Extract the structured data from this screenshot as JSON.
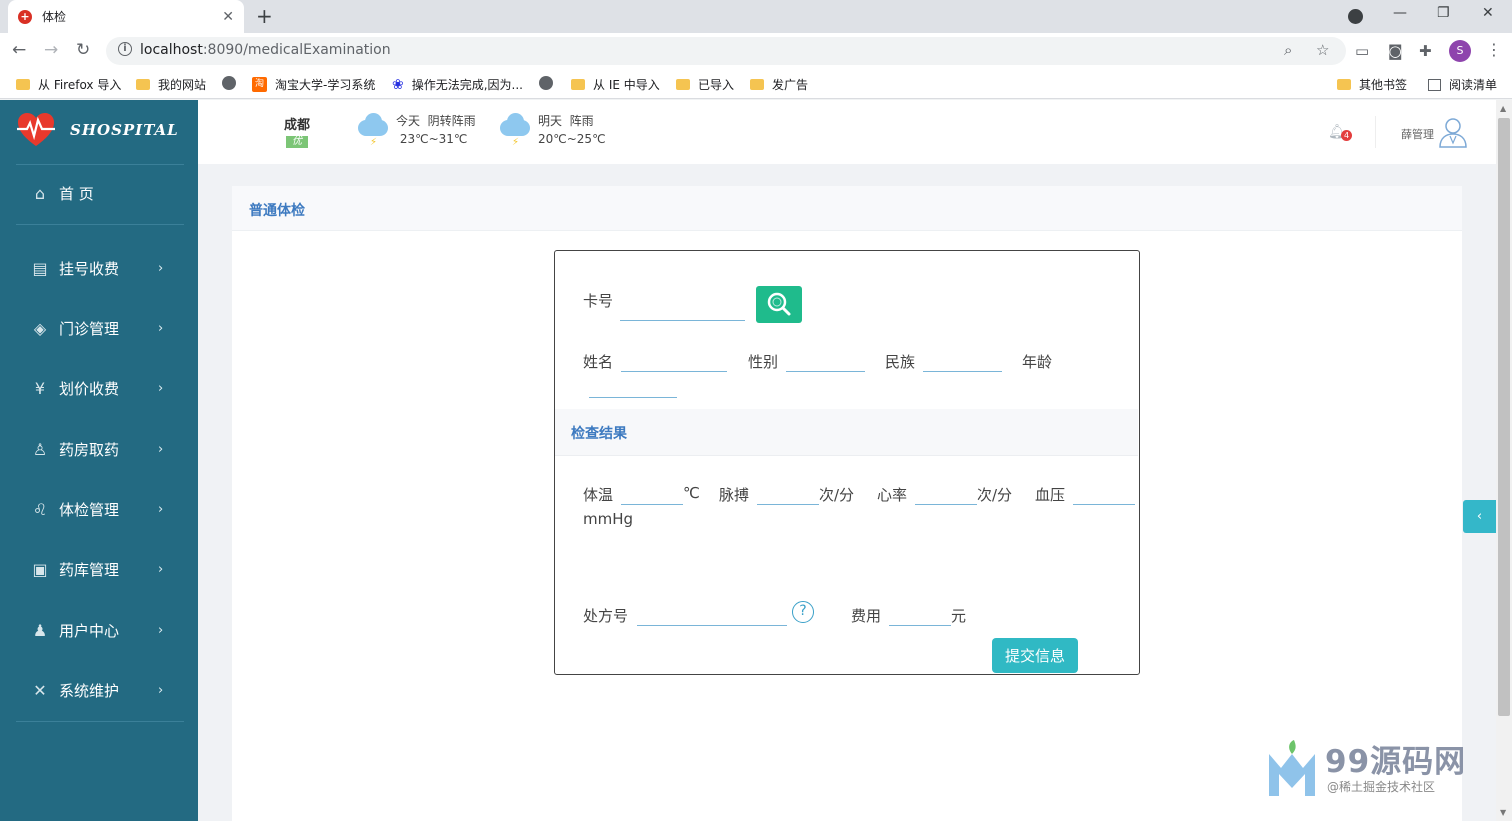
{
  "browser": {
    "tab_title": "体检",
    "url_host": "localhost",
    "url_path": ":8090/medicalExamination",
    "profile_initial": "S",
    "bookmarks": [
      {
        "label": "从 Firefox 导入",
        "icon": "folder-icon"
      },
      {
        "label": "我的网站",
        "icon": "folder-icon"
      },
      {
        "label": "",
        "icon": "globe-icon"
      },
      {
        "label": "淘宝大学-学习系统",
        "icon": "taobao-icon"
      },
      {
        "label": "操作无法完成,因为...",
        "icon": "baidu-paw-icon"
      },
      {
        "label": "",
        "icon": "globe-icon"
      },
      {
        "label": "从 IE 中导入",
        "icon": "folder-icon"
      },
      {
        "label": "已导入",
        "icon": "folder-icon"
      },
      {
        "label": "发广告",
        "icon": "folder-icon"
      },
      {
        "label": "其他书签",
        "icon": "folder-icon"
      },
      {
        "label": "阅读清单",
        "icon": "reading-list-icon"
      }
    ]
  },
  "sidebar": {
    "brand": "SHOSPITAL",
    "home_label": "首 页",
    "items": [
      {
        "label": "挂号收费",
        "icon": "register-icon"
      },
      {
        "label": "门诊管理",
        "icon": "outpatient-icon"
      },
      {
        "label": "划价收费",
        "icon": "pricing-icon"
      },
      {
        "label": "药房取药",
        "icon": "pharmacy-icon"
      },
      {
        "label": "体检管理",
        "icon": "stethoscope-icon"
      },
      {
        "label": "药库管理",
        "icon": "warehouse-icon"
      },
      {
        "label": "用户中心",
        "icon": "user-icon"
      },
      {
        "label": "系统维护",
        "icon": "tools-icon"
      }
    ]
  },
  "header": {
    "city": "成都",
    "aqi": "优",
    "today": {
      "day": "今天",
      "desc": "阴转阵雨",
      "temp": "23℃~31℃"
    },
    "tomorrow": {
      "day": "明天",
      "desc": "阵雨",
      "temp": "20℃~25℃"
    },
    "notifications": "4",
    "username": "薛管理"
  },
  "main": {
    "card_title": "普通体检",
    "form": {
      "card_no_label": "卡号",
      "name_label": "姓名",
      "gender_label": "性别",
      "ethnicity_label": "民族",
      "age_label": "年龄",
      "result_section_title": "检查结果",
      "temperature_label": "体温",
      "temperature_unit": "℃",
      "pulse_label": "脉搏",
      "pulse_unit": "次/分",
      "heart_rate_label": "心率",
      "heart_rate_unit": "次/分",
      "blood_pressure_label": "血压",
      "blood_pressure_unit": "mmHg",
      "prescription_label": "处方号",
      "fee_label": "费用",
      "fee_unit": "元",
      "submit_label": "提交信息"
    }
  },
  "watermark": {
    "title": "99源码网",
    "subtitle": "@稀土掘金技术社区"
  },
  "colors": {
    "sidebar_bg": "#236a82",
    "accent_blue": "#3d7ac0",
    "search_green": "#1fbb8c",
    "submit_teal": "#30b9c4"
  }
}
